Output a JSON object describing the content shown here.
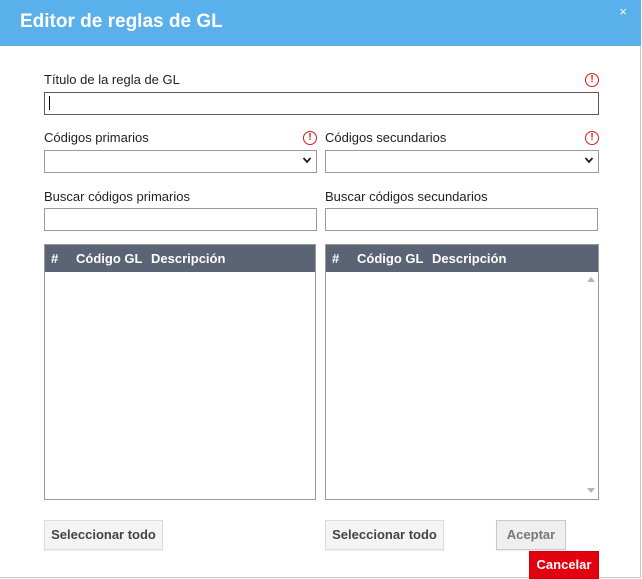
{
  "dialog": {
    "title": "Editor de reglas de GL",
    "close_glyph": "×"
  },
  "form": {
    "rule_title_label": "Título de la regla de GL",
    "rule_title_value": "",
    "primary_codes_label": "Códigos primarios",
    "primary_codes_value": "",
    "secondary_codes_label": "Códigos secundarios",
    "secondary_codes_value": "",
    "search_primary_label": "Buscar códigos primarios",
    "search_primary_value": "",
    "search_secondary_label": "Buscar códigos secundarios",
    "search_secondary_value": "",
    "required_glyph": "!"
  },
  "primary_grid": {
    "columns": [
      "#",
      "Código GL",
      "Descripción"
    ],
    "rows": []
  },
  "secondary_grid": {
    "columns": [
      "#",
      "Código GL",
      "Descripción"
    ],
    "rows": []
  },
  "buttons": {
    "select_all_primary": "Seleccionar todo",
    "select_all_secondary": "Seleccionar todo",
    "accept": "Aceptar",
    "cancel": "Cancelar"
  },
  "colors": {
    "titlebar": "#5ab0ea",
    "grid_header": "#5a6474",
    "required_icon": "#e01818",
    "cancel_button": "#e3000f"
  },
  "icons": {
    "close": "close-icon",
    "required": "required-field-icon",
    "dropdown": "chevron-down-icon",
    "scroll_up": "scroll-up-icon",
    "scroll_down": "scroll-down-icon"
  }
}
